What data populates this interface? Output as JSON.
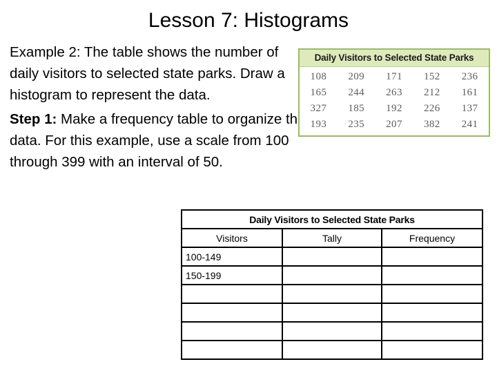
{
  "slide": {
    "title": "Lesson 7: Histograms"
  },
  "body": {
    "paragraph1": "Example 2: The table shows the number of daily visitors to selected state parks. Draw a histogram to represent the data.",
    "step_label": "Step 1:",
    "paragraph2": " Make a frequency table to organize the data. For this example, use a scale from 100 through 399 with an interval of 50."
  },
  "source_table": {
    "caption": "Daily Visitors to Selected State Parks",
    "border_color": "#9cbb5e",
    "header_fill": "#dfeabc",
    "value_color": "#5c5c5c",
    "rows": [
      [
        "108",
        "209",
        "171",
        "152",
        "236"
      ],
      [
        "165",
        "244",
        "263",
        "212",
        "161"
      ],
      [
        "327",
        "185",
        "192",
        "226",
        "137"
      ],
      [
        "193",
        "235",
        "207",
        "382",
        "241"
      ]
    ]
  },
  "frequency_table": {
    "title": "Daily Visitors to Selected State Parks",
    "columns": [
      "Visitors",
      "Tally",
      "Frequency"
    ],
    "rows": [
      [
        "100-149",
        "",
        ""
      ],
      [
        "150-199",
        "",
        ""
      ],
      [
        "",
        "",
        ""
      ],
      [
        "",
        "",
        ""
      ],
      [
        "",
        "",
        ""
      ],
      [
        "",
        "",
        ""
      ]
    ]
  }
}
